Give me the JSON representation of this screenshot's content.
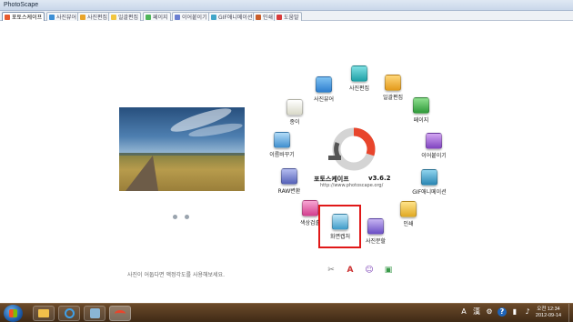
{
  "window": {
    "title": "PhotoScape"
  },
  "tabs": [
    {
      "label": "포토스케이프",
      "color": "#e85b2d"
    },
    {
      "label": "사진뷰어",
      "color": "#3c8fd6"
    },
    {
      "label": "사진편집",
      "color": "#e9a52b"
    },
    {
      "label": "일괄편집",
      "color": "#f2c640"
    },
    {
      "label": "페이지",
      "color": "#4eb55a"
    },
    {
      "label": "이어붙이기",
      "color": "#6a7fd1"
    },
    {
      "label": "GIF애니메이션",
      "color": "#41a6c9"
    },
    {
      "label": "인쇄",
      "color": "#c95d2a"
    },
    {
      "label": "도움말",
      "color": "#d83b3b"
    }
  ],
  "logo": {
    "name": "포토스케이프",
    "version": "v3.6.2",
    "url": "http://www.photoscape.org/"
  },
  "menu": [
    {
      "id": "viewer",
      "label": "사진뷰어",
      "color": "#3c8fd6",
      "icon": "viewer-icon"
    },
    {
      "id": "editor",
      "label": "사진편집",
      "color": "#28b3b8",
      "icon": "editor-icon"
    },
    {
      "id": "batch",
      "label": "일괄편집",
      "color": "#f2b637",
      "icon": "batch-icon"
    },
    {
      "id": "page",
      "label": "페이지",
      "color": "#57b65c",
      "icon": "page-icon"
    },
    {
      "id": "combine",
      "label": "이어붙이기",
      "color": "#9b66c9",
      "icon": "combine-icon"
    },
    {
      "id": "gif",
      "label": "GIF애니메이션",
      "color": "#41a6c9",
      "icon": "gif-icon"
    },
    {
      "id": "print",
      "label": "인쇄",
      "color": "#f0c040",
      "icon": "print-icon"
    },
    {
      "id": "splitter",
      "label": "사진분할",
      "color": "#8a6ed0",
      "icon": "splitter-icon"
    },
    {
      "id": "screen",
      "label": "화면캡처",
      "color": "#5fb6d9",
      "icon": "screen-capture-icon"
    },
    {
      "id": "color",
      "label": "색상검출",
      "color": "#e65aa6",
      "icon": "color-picker-icon"
    },
    {
      "id": "raw",
      "label": "RAW변환",
      "color": "#7a86c9",
      "icon": "raw-icon"
    },
    {
      "id": "rename",
      "label": "이름바꾸기",
      "color": "#5aa6d9",
      "icon": "rename-icon"
    },
    {
      "id": "paper",
      "label": "종이",
      "color": "#dcdcd0",
      "icon": "paper-icon"
    }
  ],
  "hint": "사진이 어둡다면 액정각도를 사용해보세요.",
  "taskbar": {
    "clock_time": "오전 12:34",
    "clock_date": "2012-09-14"
  }
}
